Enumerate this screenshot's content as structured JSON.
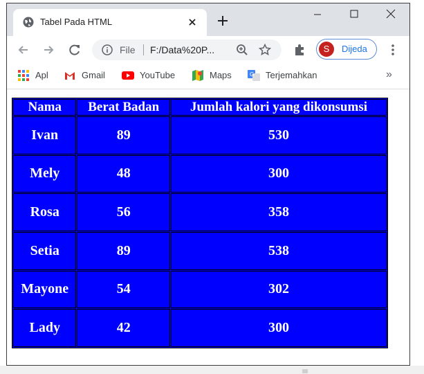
{
  "browser": {
    "tab": {
      "title": "Tabel Pada HTML"
    },
    "address": {
      "file_label": "File",
      "url": "F:/Data%20P..."
    },
    "profile": {
      "initial": "S",
      "name": "Dijeda"
    },
    "bookmarks": [
      {
        "label": "Apl",
        "icon": "apps-grid-icon"
      },
      {
        "label": "Gmail",
        "icon": "gmail-icon"
      },
      {
        "label": "YouTube",
        "icon": "youtube-icon"
      },
      {
        "label": "Maps",
        "icon": "maps-icon"
      },
      {
        "label": "Terjemahkan",
        "icon": "translate-icon"
      }
    ],
    "more_bookmarks": "»"
  },
  "table": {
    "headers": [
      "Nama",
      "Berat Badan",
      "Jumlah kalori yang dikonsumsi"
    ],
    "rows": [
      [
        "Ivan",
        "89",
        "530"
      ],
      [
        "Mely",
        "48",
        "300"
      ],
      [
        "Rosa",
        "56",
        "358"
      ],
      [
        "Setia",
        "89",
        "538"
      ],
      [
        "Mayone",
        "54",
        "302"
      ],
      [
        "Lady",
        "42",
        "300"
      ]
    ]
  },
  "colors": {
    "table_bg": "#0000ff",
    "table_text": "#ffffff",
    "tabstrip_bg": "#dee1e6",
    "avatar": "#c5221f",
    "profile_text": "#1a73e8"
  }
}
